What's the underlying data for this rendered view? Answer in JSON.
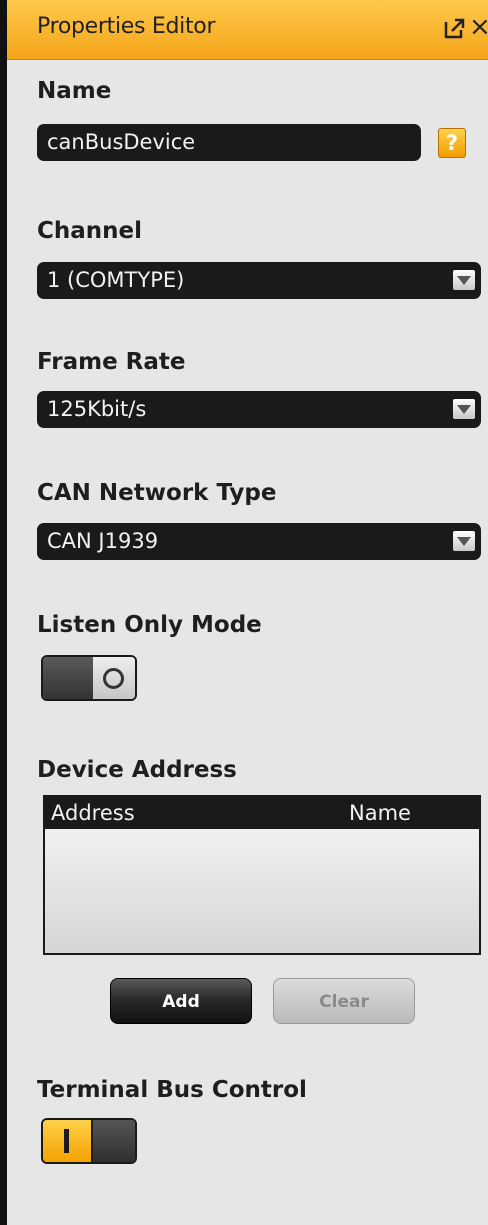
{
  "panel": {
    "title": "Properties Editor",
    "popout_icon": "popout-icon",
    "close_icon": "close-icon",
    "close_glyph": "×"
  },
  "name": {
    "label": "Name",
    "value": "canBusDevice",
    "help_glyph": "?"
  },
  "channel": {
    "label": "Channel",
    "selected": "1 (COMTYPE)"
  },
  "frame_rate": {
    "label": "Frame Rate",
    "selected": "125Kbit/s"
  },
  "can_network_type": {
    "label": "CAN Network Type",
    "selected": "CAN J1939"
  },
  "listen_only_mode": {
    "label": "Listen Only Mode",
    "state": "off"
  },
  "device_address": {
    "label": "Device Address",
    "columns": [
      "Address",
      "Name"
    ],
    "rows": [],
    "add_label": "Add",
    "clear_label": "Clear"
  },
  "terminal_bus_control": {
    "label": "Terminal Bus Control",
    "state": "on"
  },
  "colors": {
    "accent": "#f4a51a",
    "panel_bg": "#e6e6e6",
    "field_bg": "#1a1a1a"
  }
}
